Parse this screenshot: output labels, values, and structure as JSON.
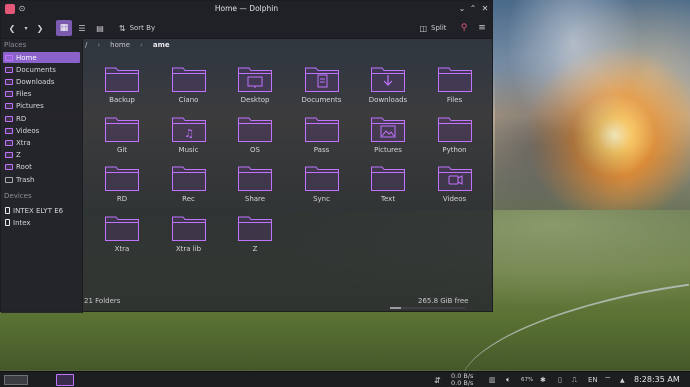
{
  "window": {
    "title": "Home — Dolphin",
    "colors": {
      "accent": "#8a62c9",
      "folder": "#c073ff"
    }
  },
  "toolbar": {
    "sort_label": "Sort By",
    "split_label": "Split",
    "icons": [
      "back-icon",
      "forward-icon",
      "icons-view-icon",
      "compact-view-icon",
      "details-view-icon",
      "sort-icon",
      "split-icon",
      "search-icon",
      "menu-icon"
    ]
  },
  "sidebar": {
    "places_header": "Places",
    "places": [
      {
        "label": "Home"
      },
      {
        "label": "Documents"
      },
      {
        "label": "Downloads"
      },
      {
        "label": "Files"
      },
      {
        "label": "Pictures"
      },
      {
        "label": "RD"
      },
      {
        "label": "Videos"
      },
      {
        "label": "Xtra"
      },
      {
        "label": "Z"
      },
      {
        "label": "Root"
      },
      {
        "label": "Trash"
      }
    ],
    "devices_header": "Devices",
    "devices": [
      {
        "label": "INTEX ELYT E6"
      },
      {
        "label": "Intex"
      }
    ]
  },
  "breadcrumb": {
    "root": "/",
    "home": "home",
    "current": "ame"
  },
  "folders": [
    {
      "name": "Backup",
      "emblem": ""
    },
    {
      "name": "Ciano",
      "emblem": ""
    },
    {
      "name": "Desktop",
      "emblem": "desktop"
    },
    {
      "name": "Documents",
      "emblem": "document"
    },
    {
      "name": "Downloads",
      "emblem": "download"
    },
    {
      "name": "Files",
      "emblem": ""
    },
    {
      "name": "Git",
      "emblem": ""
    },
    {
      "name": "Music",
      "emblem": "music"
    },
    {
      "name": "OS",
      "emblem": ""
    },
    {
      "name": "Pass",
      "emblem": ""
    },
    {
      "name": "Pictures",
      "emblem": "picture"
    },
    {
      "name": "Python",
      "emblem": ""
    },
    {
      "name": "RD",
      "emblem": ""
    },
    {
      "name": "Rec",
      "emblem": ""
    },
    {
      "name": "Share",
      "emblem": ""
    },
    {
      "name": "Sync",
      "emblem": ""
    },
    {
      "name": "Text",
      "emblem": ""
    },
    {
      "name": "Videos",
      "emblem": "video"
    },
    {
      "name": "Xtra",
      "emblem": ""
    },
    {
      "name": "Xtra lib",
      "emblem": ""
    },
    {
      "name": "Z",
      "emblem": ""
    }
  ],
  "status": {
    "count": "21 Folders",
    "free": "265.8 GiB free",
    "used_fraction": 0.15
  },
  "taskbar": {
    "net_up": "0.0 B/s",
    "net_down": "0.0 B/s",
    "battery": "67%",
    "language": "EN",
    "clock": "8:28:35 AM"
  }
}
